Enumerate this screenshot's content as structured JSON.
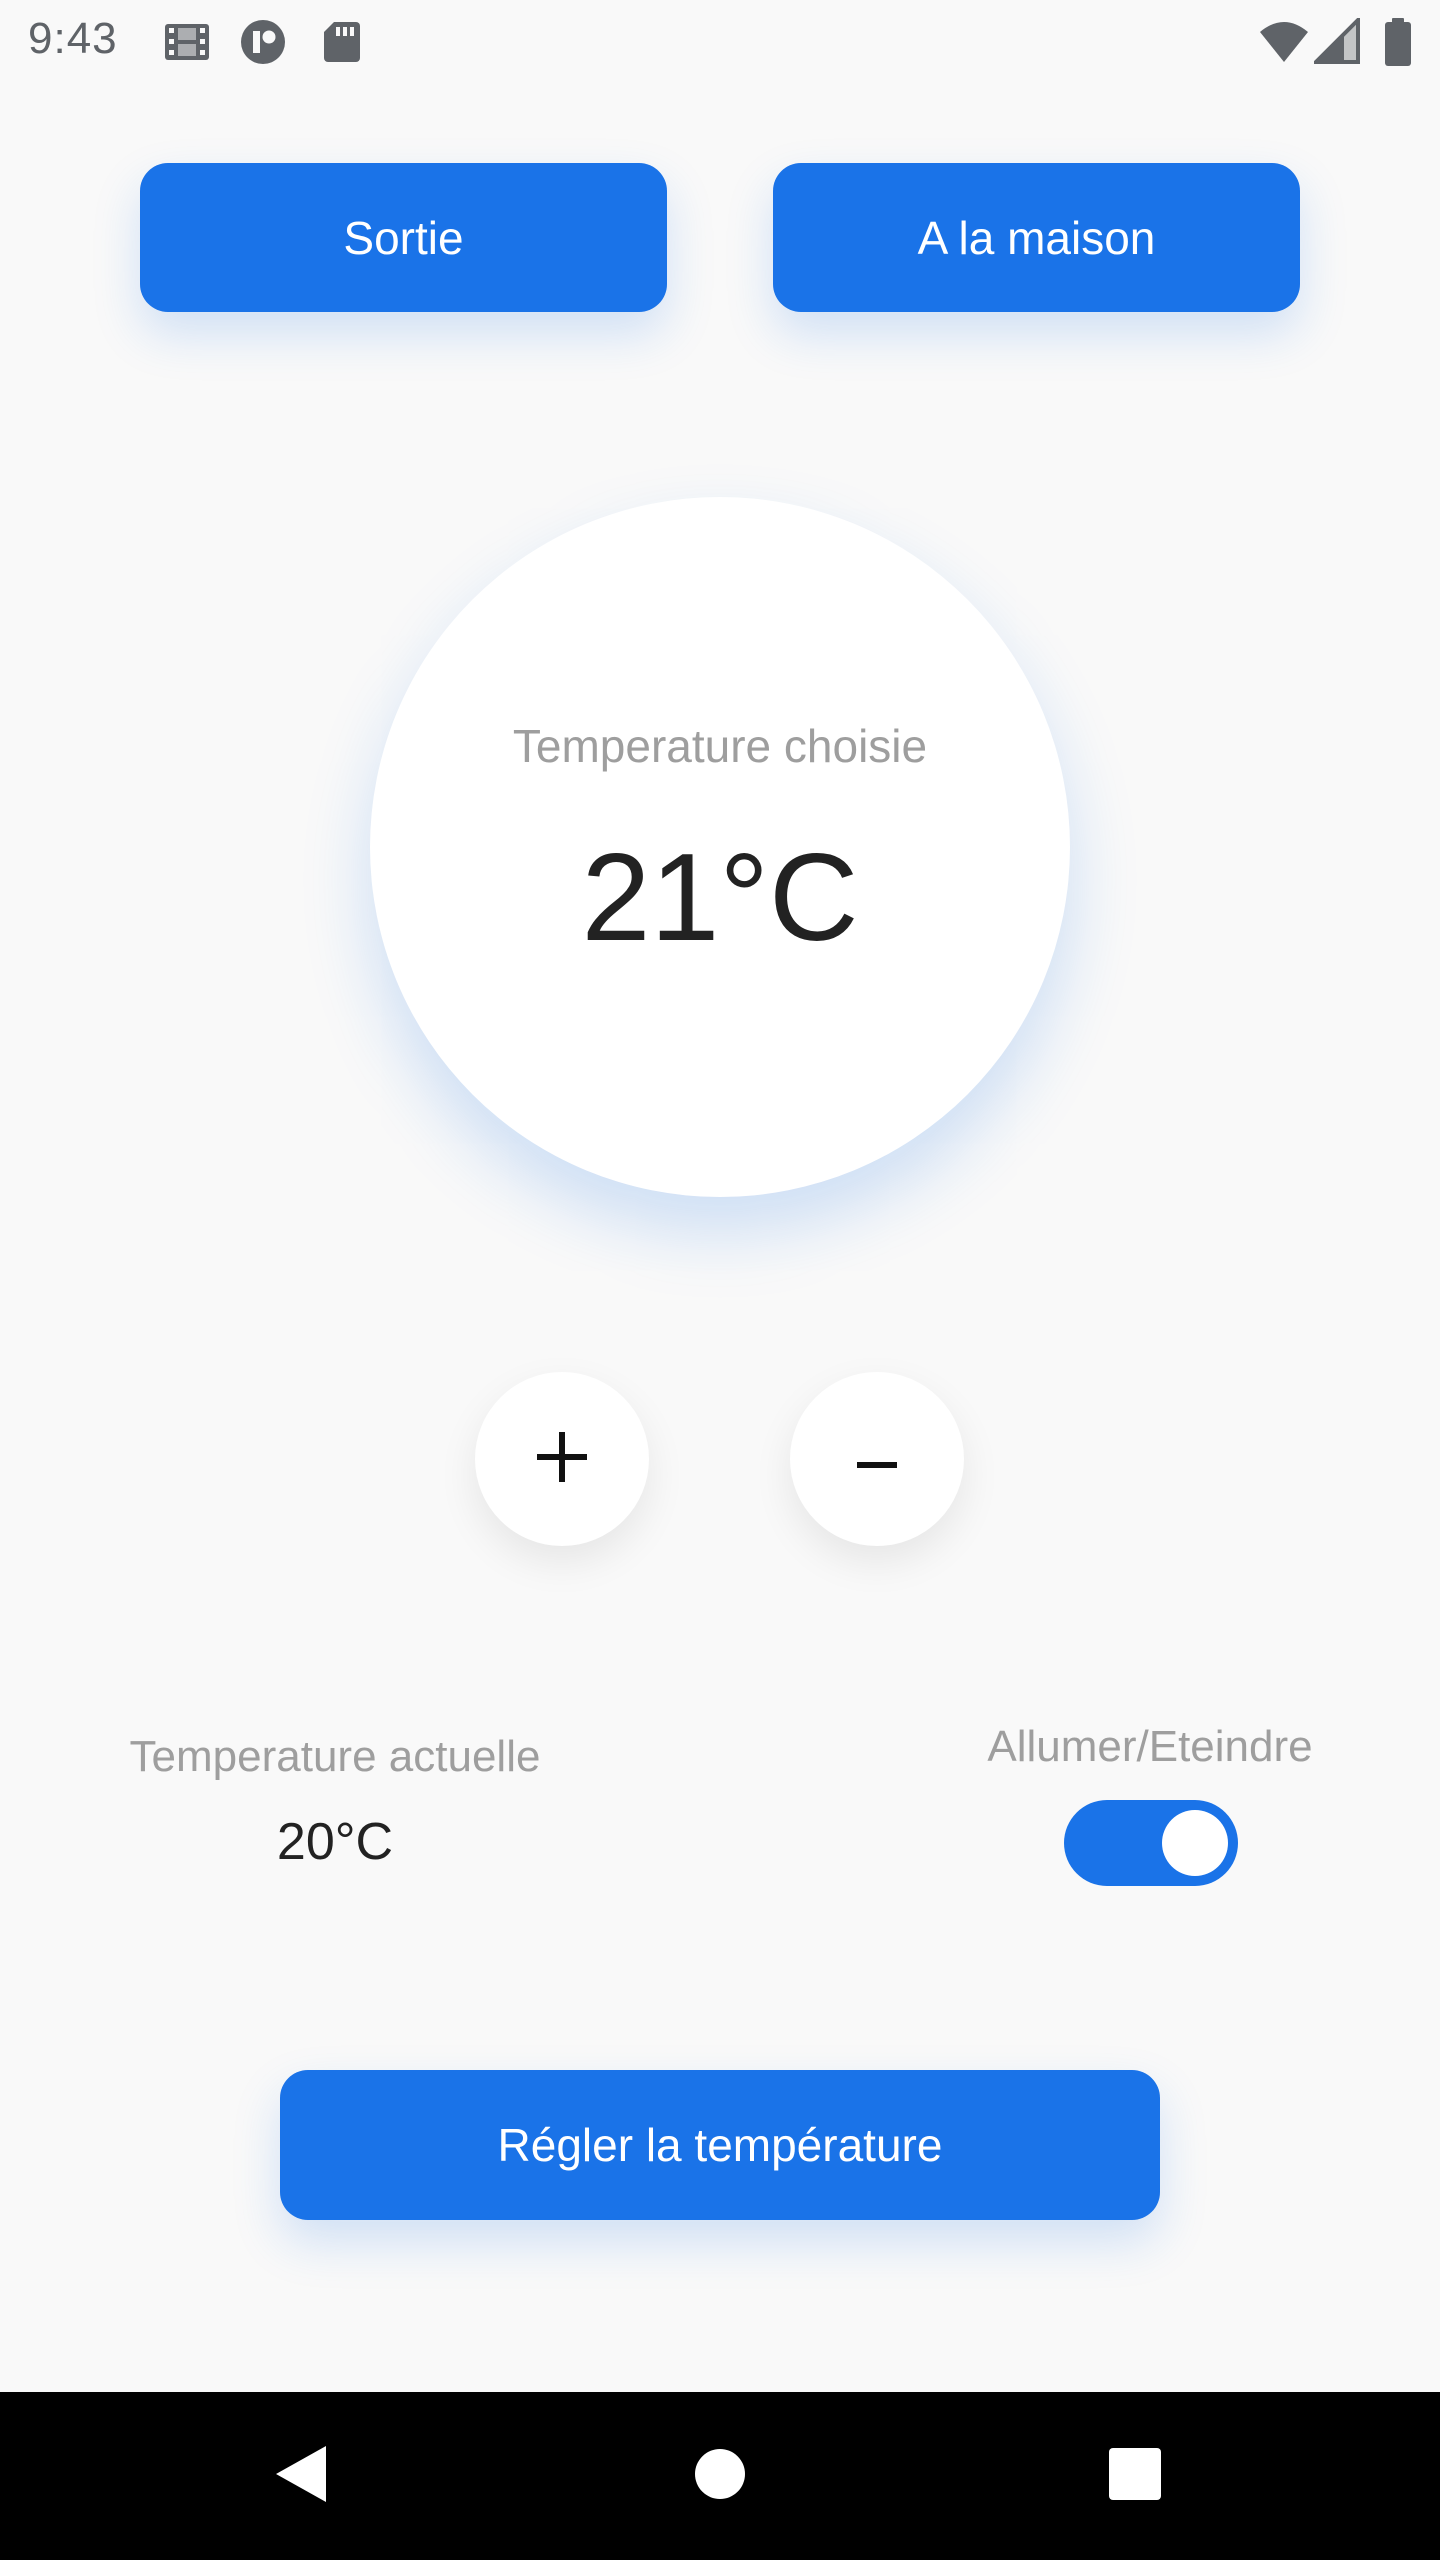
{
  "status_bar": {
    "time": "9:43",
    "icons_left": [
      "film-icon",
      "app-notification-icon",
      "sd-card-icon"
    ],
    "icons_right": [
      "wifi-icon",
      "signal-icon",
      "battery-icon"
    ]
  },
  "modes": {
    "sortie_label": "Sortie",
    "maison_label": "A la maison"
  },
  "dial": {
    "label": "Temperature choisie",
    "value": "21°C"
  },
  "controls": {
    "plus_icon": "plus-icon",
    "minus_icon": "minus-icon"
  },
  "current": {
    "label": "Temperature actuelle",
    "value": "20°C"
  },
  "power": {
    "label": "Allumer/Eteindre",
    "on": true
  },
  "actions": {
    "set_label": "Régler la température"
  },
  "nav": {
    "icons": [
      "back-icon",
      "home-icon",
      "recent-apps-icon"
    ]
  },
  "colors": {
    "accent": "#1a73e8",
    "background": "#f9f9f9",
    "muted_text": "#9e9e9e",
    "nav_bar": "#000000"
  }
}
